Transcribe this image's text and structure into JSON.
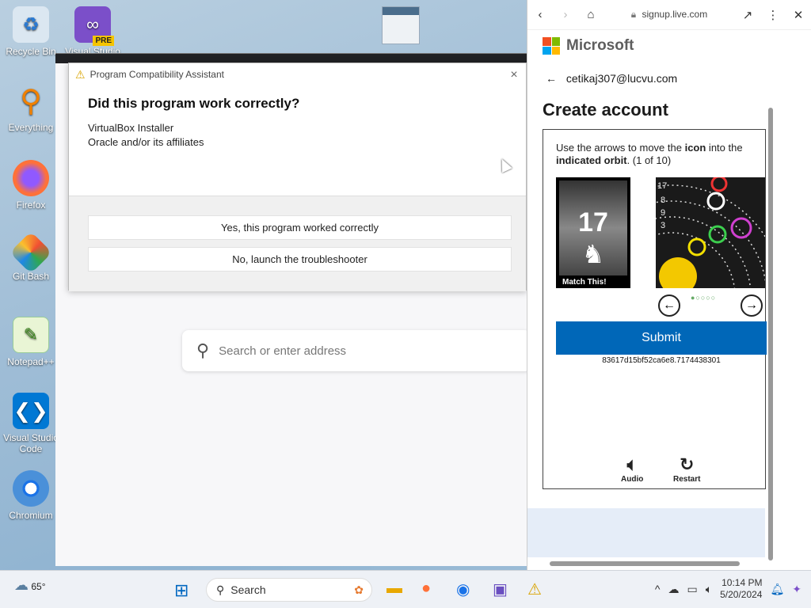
{
  "desktop": {
    "icons": [
      {
        "label": "Recycle Bin"
      },
      {
        "label": "Visual Studio"
      },
      {
        "label": "Everything"
      },
      {
        "label": "Firefox"
      },
      {
        "label": "Git Bash"
      },
      {
        "label": "Notepad++"
      },
      {
        "label": "Visual Studio Code"
      },
      {
        "label": "Chromium"
      }
    ],
    "pre_badge": "PRE"
  },
  "background_browser": {
    "search_placeholder": "Search or enter address"
  },
  "pca_dialog": {
    "title": "Program Compatibility Assistant",
    "heading": "Did this program work correctly?",
    "program_name": "VirtualBox Installer",
    "publisher": "Oracle and/or its affiliates",
    "option_yes": "Yes, this program worked correctly",
    "option_no": "No, launch the troubleshooter",
    "close_glyph": "×"
  },
  "signup_panel": {
    "url": "signup.live.com",
    "brand": "Microsoft",
    "account_email": "cetikaj307@lucvu.com",
    "heading": "Create account",
    "captcha": {
      "instruction_pre": "Use the arrows to move the ",
      "instruction_bold1": "icon",
      "instruction_mid": " into the ",
      "instruction_bold2": "indicated orbit",
      "instruction_post": ". (1 of 10)",
      "match_number": "17",
      "match_caption": "Match This!",
      "submit_label": "Submit",
      "session_id": "83617d15bf52ca6e8.7174438301",
      "audio_label": "Audio",
      "restart_label": "Restart"
    }
  },
  "taskbar": {
    "weather_temp": "65°",
    "search_label": "Search",
    "clock_time": "10:14 PM",
    "clock_date": "5/20/2024"
  }
}
